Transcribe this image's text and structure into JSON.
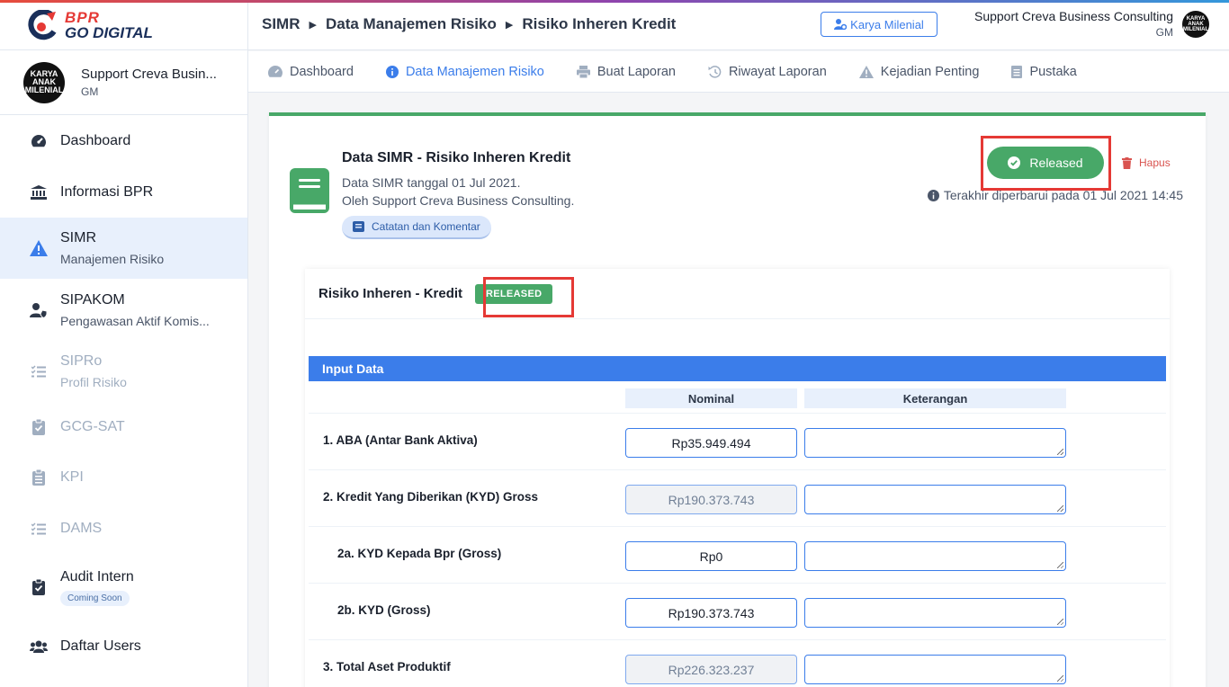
{
  "brand": {
    "line1": "BPR",
    "line2": "GO DIGITAL"
  },
  "sidebar": {
    "user": {
      "avatar_text": "KARYA ANAK MILENIAL",
      "name": "Support Creva Busin...",
      "role": "GM"
    },
    "items": [
      {
        "label": "Dashboard",
        "sub": "",
        "icon": "dashboard-gauge-icon",
        "state": "normal"
      },
      {
        "label": "Informasi BPR",
        "sub": "",
        "icon": "bank-icon",
        "state": "normal"
      },
      {
        "label": "SIMR",
        "sub": "Manajemen Risiko",
        "icon": "warning-icon",
        "state": "active"
      },
      {
        "label": "SIPAKOM",
        "sub": "Pengawasan Aktif Komis...",
        "icon": "user-shield-icon",
        "state": "normal"
      },
      {
        "label": "SIPRo",
        "sub": "Profil Risiko",
        "icon": "list-check-icon",
        "state": "disabled"
      },
      {
        "label": "GCG-SAT",
        "sub": "",
        "icon": "clipboard-check-icon",
        "state": "disabled"
      },
      {
        "label": "KPI",
        "sub": "",
        "icon": "clipboard-list-icon",
        "state": "disabled"
      },
      {
        "label": "DAMS",
        "sub": "",
        "icon": "list-check-icon",
        "state": "disabled"
      },
      {
        "label": "Audit Intern",
        "sub": "",
        "badge": "Coming Soon",
        "icon": "clipboard-check-icon",
        "state": "normal"
      },
      {
        "label": "Daftar Users",
        "sub": "",
        "icon": "users-icon",
        "state": "normal"
      }
    ]
  },
  "topbar": {
    "breadcrumb": [
      "SIMR",
      "Data Manajemen Risiko",
      "Risiko Inheren Kredit"
    ],
    "karya_button": "Karya Milenial",
    "user_name": "Support Creva Business Consulting",
    "user_role": "GM",
    "avatar_text": "KARYA ANAK MILENIAL"
  },
  "tabs": [
    {
      "label": "Dashboard",
      "icon": "gauge-icon",
      "active": false
    },
    {
      "label": "Data Manajemen Risiko",
      "icon": "info-circle-icon",
      "active": true
    },
    {
      "label": "Buat Laporan",
      "icon": "print-icon",
      "active": false
    },
    {
      "label": "Riwayat Laporan",
      "icon": "history-icon",
      "active": false
    },
    {
      "label": "Kejadian Penting",
      "icon": "warning-icon",
      "active": false
    },
    {
      "label": "Pustaka",
      "icon": "file-icon",
      "active": false
    }
  ],
  "document": {
    "title": "Data SIMR - Risiko Inheren Kredit",
    "line1": "Data SIMR tanggal 01 Jul 2021.",
    "line2": "Oleh Support Creva Business Consulting.",
    "notes_button": "Catatan dan Komentar",
    "status_button": "Released",
    "delete_button": "Hapus",
    "updated": "Terakhir diperbarui pada 01 Jul 2021 14:45"
  },
  "section": {
    "title": "Risiko Inheren - Kredit",
    "badge": "RELEASED",
    "input_header": "Input Data",
    "col_nominal": "Nominal",
    "col_keterangan": "Keterangan",
    "rows": [
      {
        "label": "1. ABA (Antar Bank Aktiva)",
        "value": "Rp35.949.494",
        "readonly": false,
        "indent": false
      },
      {
        "label": "2. Kredit Yang Diberikan (KYD) Gross",
        "value": "Rp190.373.743",
        "readonly": true,
        "indent": false
      },
      {
        "label": "2a. KYD Kepada Bpr (Gross)",
        "value": "Rp0",
        "readonly": false,
        "indent": true
      },
      {
        "label": "2b. KYD (Gross)",
        "value": "Rp190.373.743",
        "readonly": false,
        "indent": true
      },
      {
        "label": "3. Total Aset Produktif",
        "value": "Rp226.323.237",
        "readonly": true,
        "indent": false
      }
    ]
  },
  "colors": {
    "primary": "#3b7dea",
    "success": "#48a868",
    "danger": "#d9534f",
    "highlight": "#e53935"
  }
}
